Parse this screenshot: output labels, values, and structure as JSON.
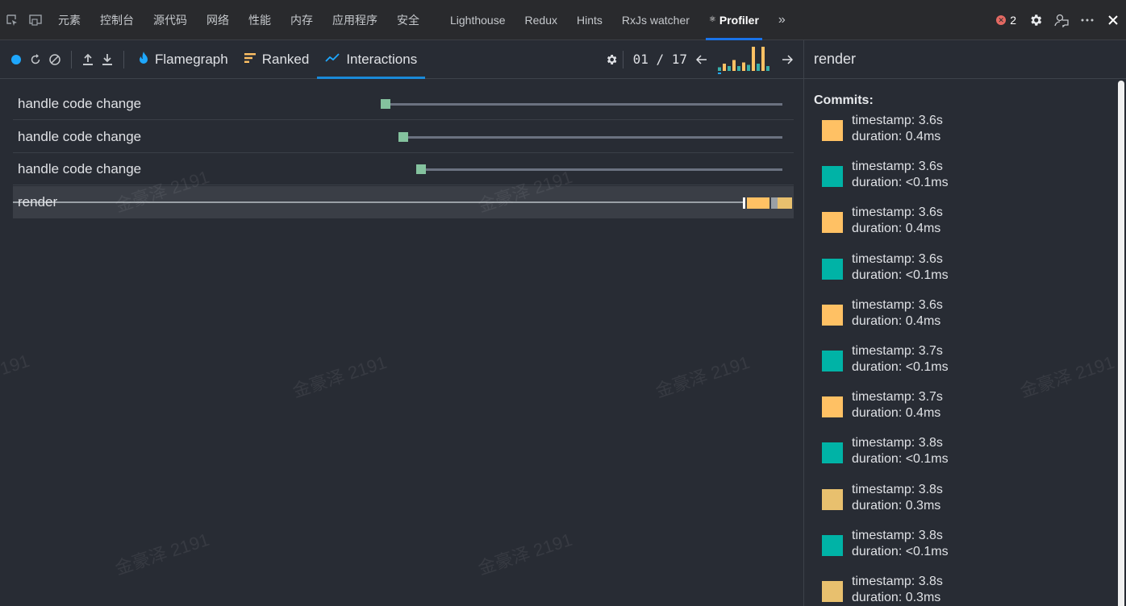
{
  "devtools_tabs": [
    "元素",
    "控制台",
    "源代码",
    "网络",
    "性能",
    "内存",
    "应用程序",
    "安全",
    "Lighthouse",
    "Redux",
    "Hints",
    "RxJs watcher"
  ],
  "active_tab": {
    "dot": "⚛",
    "label": "Profiler"
  },
  "overflow_label": "»",
  "error_count": "2",
  "error_icon": "✕",
  "toolbar": {
    "tabs": [
      {
        "icon": "flame-icon",
        "label": "Flamegraph"
      },
      {
        "icon": "ranked-icon",
        "label": "Ranked"
      },
      {
        "icon": "interactions-icon",
        "label": "Interactions"
      }
    ],
    "commit_counter": "01 / 17",
    "minibars": [
      0.15,
      0.3,
      0.2,
      0.45,
      0.2,
      0.35,
      0.25,
      1.0,
      0.3,
      1.0,
      0.2
    ],
    "minibar_colors": [
      "#37afa9",
      "#ffc164"
    ]
  },
  "interactions": [
    {
      "name": "handle code change",
      "start": 0.477,
      "marker": 0.477
    },
    {
      "name": "handle code change",
      "start": 0.5,
      "marker": 0.5
    },
    {
      "name": "handle code change",
      "start": 0.523,
      "marker": 0.523
    },
    {
      "name": "render",
      "selected": true
    }
  ],
  "side_panel": {
    "title": "render",
    "commits_label": "Commits:",
    "commits": [
      {
        "color": "#ffc164",
        "timestamp": "timestamp: 3.6s",
        "duration": "duration: 0.4ms"
      },
      {
        "color": "#00b3a6",
        "timestamp": "timestamp: 3.6s",
        "duration": "duration: <0.1ms"
      },
      {
        "color": "#ffc164",
        "timestamp": "timestamp: 3.6s",
        "duration": "duration: 0.4ms"
      },
      {
        "color": "#00b3a6",
        "timestamp": "timestamp: 3.6s",
        "duration": "duration: <0.1ms"
      },
      {
        "color": "#ffc164",
        "timestamp": "timestamp: 3.6s",
        "duration": "duration: 0.4ms"
      },
      {
        "color": "#00b3a6",
        "timestamp": "timestamp: 3.7s",
        "duration": "duration: <0.1ms"
      },
      {
        "color": "#ffc164",
        "timestamp": "timestamp: 3.7s",
        "duration": "duration: 0.4ms"
      },
      {
        "color": "#00b3a6",
        "timestamp": "timestamp: 3.8s",
        "duration": "duration: <0.1ms"
      },
      {
        "color": "#e8c06e",
        "timestamp": "timestamp: 3.8s",
        "duration": "duration: 0.3ms"
      },
      {
        "color": "#00b3a6",
        "timestamp": "timestamp: 3.8s",
        "duration": "duration: <0.1ms"
      },
      {
        "color": "#e8c06e",
        "timestamp": "timestamp: 3.8s",
        "duration": "duration: 0.3ms"
      }
    ]
  },
  "watermark": "金豪泽 2191",
  "watermark_fragment": "191"
}
